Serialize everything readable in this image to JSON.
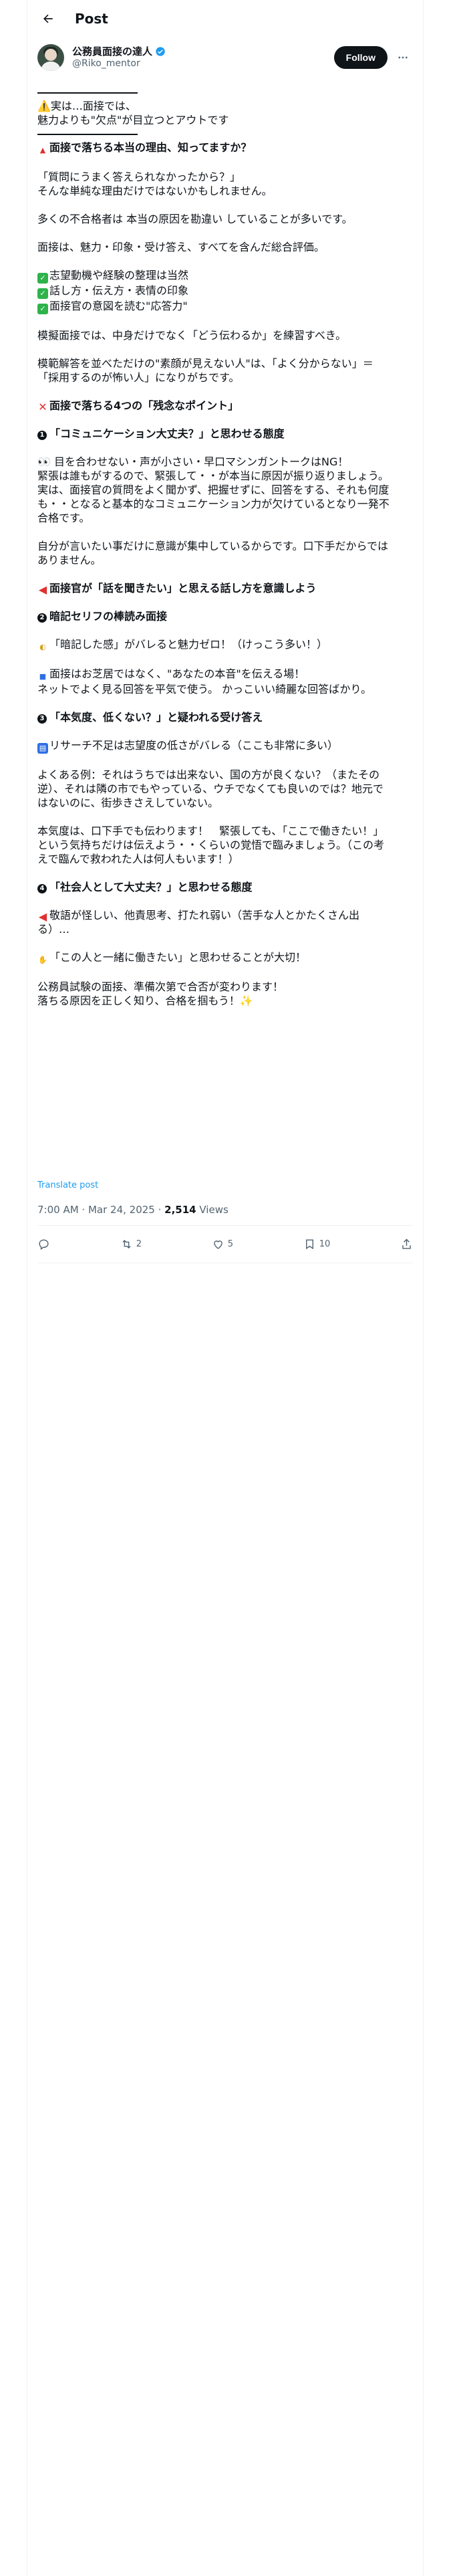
{
  "header": {
    "title": "Post"
  },
  "author": {
    "name": "公務員面接の達人",
    "handle": "@Riko_mentor",
    "follow_label": "Follow"
  },
  "post": {
    "intro1": "⚠️実は…面接では、",
    "intro2": "魅力よりも\"欠点\"が目立つとアウトです",
    "q_heading": "面接で落ちる本当の理由、知ってますか？",
    "p1a": "「質問にうまく答えられなかったから？」",
    "p1b": "そんな単純な理由だけではないかもしれません。",
    "p2": "多くの不合格者は 本当の原因を勘違い していることが多いです。",
    "p3": "面接は、魅力・印象・受け答え、すべてを含んだ総合評価。",
    "c1": "志望動機や経験の整理は当然",
    "c2": "話し方・伝え方・表情の印象",
    "c3": "面接官の意図を読む\"応答力\"",
    "p4": "模擬面接では、中身だけでなく「どう伝わるか」を練習すべき。",
    "p5a": "模範解答を並べただけの\"素顔が見えない人\"は、「よく分からない」＝",
    "p5b": "「採用するのが怖い人」になりがちです。",
    "h4": "面接で落ちる4つの「残念なポイント」",
    "s1_title": "「コミュニケーション大丈夫？」と思わせる態度",
    "s1_p1a": "👀 目を合わせない・声が小さい・早口マシンガントークはNG！",
    "s1_p1b": "緊張は誰もがするので、緊張して・・が本当に原因が振り返りましょう。",
    "s1_p1c": "実は、面接官の質問をよく聞かず、把握せずに、回答をする、それも何度",
    "s1_p1d": "も・・となると基本的なコミュニケーション力が欠けているとなり一発不",
    "s1_p1e": "合格です。",
    "s1_p2a": "自分が言いたい事だけに意識が集中しているからです。口下手だからでは",
    "s1_p2b": "ありません。",
    "s1_sub": "面接官が「話を聞きたい」と思える話し方を意識しよう",
    "s2_title": "暗記セリフの棒読み面接",
    "s2_p1": "「暗記した感」がバレると魅力ゼロ！（けっこう多い！）",
    "s2_p2a": "面接はお芝居ではなく、\"あなたの本音\"を伝える場！",
    "s2_p2b": "ネットでよく見る回答を平気で使う。 かっこいい綺麗な回答ばかり。",
    "s3_title": "「本気度、低くない？」と疑われる受け答え",
    "s3_p1": "リサーチ不足は志望度の低さがバレる（ここも非常に多い）",
    "s3_p2a": "よくある例：それはうちでは出来ない、国の方が良くない？（またその",
    "s3_p2b": "逆）、それは隣の市でもやっている、ウチでなくても良いのでは？地元で",
    "s3_p2c": "はないのに、街歩きさえしていない。",
    "s3_p3a": "本気度は、口下手でも伝わります！　緊張しても、「ここで働きたい！」",
    "s3_p3b": "という気持ちだけは伝えよう・・くらいの覚悟で臨みましょう。（この考",
    "s3_p3c": "えで臨んで救われた人は何人もいます！）",
    "s4_title": "「社会人として大丈夫？」と思わせる態度",
    "s4_p1a": "敬語が怪しい、他責思考、打たれ弱い（苦手な人とかたくさん出",
    "s4_p1b": "る）…",
    "s4_p2": "「この人と一緒に働きたい」と思わせることが大切！",
    "s4_p3a": "公務員試験の面接、準備次第で合否が変わります！",
    "s4_p3b": "落ちる原因を正しく知り、合格を掴もう！✨",
    "translate": "Translate post"
  },
  "meta": {
    "time": "7:00 AM · Mar 24, 2025 · ",
    "views": "2,514",
    "views_label": " Views"
  },
  "actions": {
    "reposts": "2",
    "likes": "5",
    "bookmarks": "10"
  },
  "icons": [
    "back-arrow-icon",
    "verified-badge-icon",
    "more-icon",
    "reply-icon",
    "repost-icon",
    "like-icon",
    "bookmark-icon",
    "share-icon"
  ]
}
